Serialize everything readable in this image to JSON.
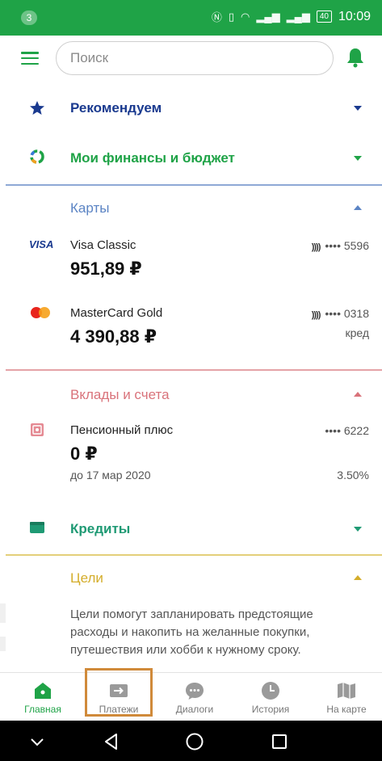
{
  "statusbar": {
    "badge": "3",
    "battery": "40",
    "time": "10:09"
  },
  "search": {
    "placeholder": "Поиск"
  },
  "sections": {
    "recommend": {
      "title": "Рекомендуем"
    },
    "finance": {
      "title": "Мои финансы и бюджет"
    },
    "cards": {
      "title": "Карты",
      "items": [
        {
          "brand": "VISA",
          "name": "Visa Classic",
          "amount": "951,89 ₽",
          "masked": "•••• 5596",
          "extra": ""
        },
        {
          "brand": "",
          "name": "MasterCard Gold",
          "amount": "4 390,88 ₽",
          "masked": "•••• 0318",
          "extra": "кред"
        }
      ]
    },
    "deposits": {
      "title": "Вклады и счета",
      "items": [
        {
          "name": "Пенсионный плюс",
          "amount": "0 ₽",
          "masked": "•••• 6222",
          "date": "до 17 мар 2020",
          "rate": "3.50%"
        }
      ]
    },
    "credits": {
      "title": "Кредиты"
    },
    "goals": {
      "title": "Цели",
      "text": "Цели помогут запланировать предстоящие расходы и накопить на желанные покупки, путешествия или хобби к нужному сроку."
    }
  },
  "bottomnav": {
    "items": [
      {
        "label": "Главная"
      },
      {
        "label": "Платежи"
      },
      {
        "label": "Диалоги"
      },
      {
        "label": "История"
      },
      {
        "label": "На карте"
      }
    ]
  },
  "colors": {
    "brand_green": "#1fa347",
    "cards_blue": "#5b84c4",
    "deposits_red": "#d9727a",
    "goals_gold": "#d4ad2b",
    "recommend_navy": "#1a3a8f",
    "highlight_orange": "#d08a3a"
  }
}
